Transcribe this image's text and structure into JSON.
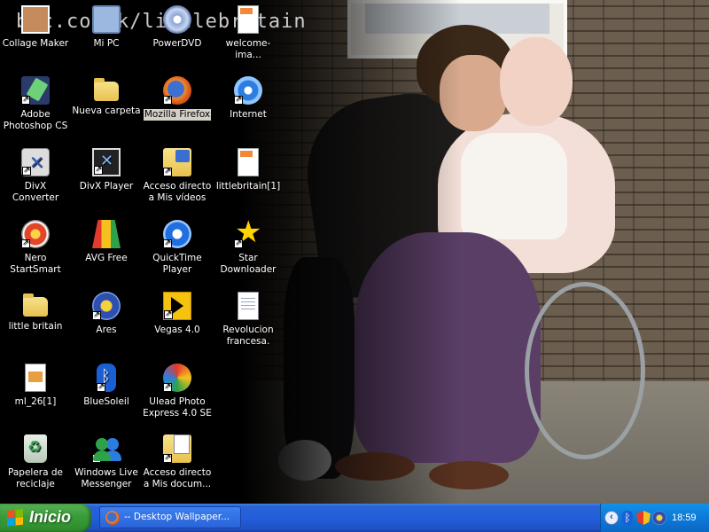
{
  "wallpaper": {
    "url_text": "bbc.co.uk/littlebritain"
  },
  "desktop_icons": [
    {
      "id": "collage-maker",
      "label": "Collage Maker",
      "icon": "photo-collage-icon",
      "shortcut": false
    },
    {
      "id": "mi-pc",
      "label": "Mi PC",
      "icon": "my-computer-icon",
      "shortcut": false
    },
    {
      "id": "powerdvd",
      "label": "PowerDVD",
      "icon": "dvd-disc-icon",
      "shortcut": false
    },
    {
      "id": "welcome-image",
      "label": "welcome-ima...",
      "icon": "png-file-icon",
      "shortcut": false
    },
    {
      "id": "photoshop",
      "label": "Adobe Photoshop CS",
      "icon": "photoshop-feather-icon",
      "shortcut": true
    },
    {
      "id": "nueva-carpeta",
      "label": "Nueva carpeta",
      "icon": "folder-icon",
      "shortcut": false
    },
    {
      "id": "firefox",
      "label": "Mozilla Firefox",
      "icon": "firefox-icon",
      "shortcut": true,
      "selected": true
    },
    {
      "id": "internet",
      "label": "Internet",
      "icon": "internet-explorer-icon",
      "shortcut": true
    },
    {
      "id": "divx-converter",
      "label": "DivX Converter",
      "icon": "divx-converter-icon",
      "shortcut": true
    },
    {
      "id": "divx-player",
      "label": "DivX Player",
      "icon": "divx-player-icon",
      "shortcut": true
    },
    {
      "id": "acceso-videos",
      "label": "Acceso directo a Mis vídeos",
      "icon": "videos-folder-icon",
      "shortcut": true
    },
    {
      "id": "littlebritain-1",
      "label": "littlebritain[1]",
      "icon": "png-file-icon",
      "shortcut": false
    },
    {
      "id": "nero",
      "label": "Nero StartSmart",
      "icon": "nero-icon",
      "shortcut": true
    },
    {
      "id": "avg",
      "label": "AVG Free",
      "icon": "avg-icon",
      "shortcut": true
    },
    {
      "id": "quicktime",
      "label": "QuickTime Player",
      "icon": "quicktime-icon",
      "shortcut": true
    },
    {
      "id": "star-downloader",
      "label": "Star Downloader",
      "icon": "star-icon",
      "shortcut": true
    },
    {
      "id": "little-britain",
      "label": "little britain",
      "icon": "folder-icon",
      "shortcut": false
    },
    {
      "id": "ares",
      "label": "Ares",
      "icon": "ares-icon",
      "shortcut": true
    },
    {
      "id": "vegas",
      "label": "Vegas 4.0",
      "icon": "vegas-icon",
      "shortcut": true
    },
    {
      "id": "revolucion",
      "label": "Revolucion francesa.",
      "icon": "document-icon",
      "shortcut": false
    },
    {
      "id": "ml-26",
      "label": "ml_26[1]",
      "icon": "image-file-icon",
      "shortcut": false
    },
    {
      "id": "bluesoleil",
      "label": "BlueSoleil",
      "icon": "bluetooth-icon",
      "shortcut": true
    },
    {
      "id": "ulead",
      "label": "Ulead Photo Express 4.0 SE",
      "icon": "ulead-icon",
      "shortcut": true
    },
    {
      "id": "papelera",
      "label": "Papelera de reciclaje",
      "icon": "recycle-bin-icon",
      "shortcut": false
    },
    {
      "id": "msn",
      "label": "Windows Live Messenger",
      "icon": "messenger-icon",
      "shortcut": true
    },
    {
      "id": "acceso-documentos",
      "label": "Acceso directo a Mis docum...",
      "icon": "documents-folder-icon",
      "shortcut": true
    }
  ],
  "taskbar": {
    "start_label": "Inicio",
    "tasks": [
      {
        "label": "-- Desktop Wallpaper...",
        "icon": "firefox-icon"
      }
    ],
    "clock": "18:59"
  }
}
